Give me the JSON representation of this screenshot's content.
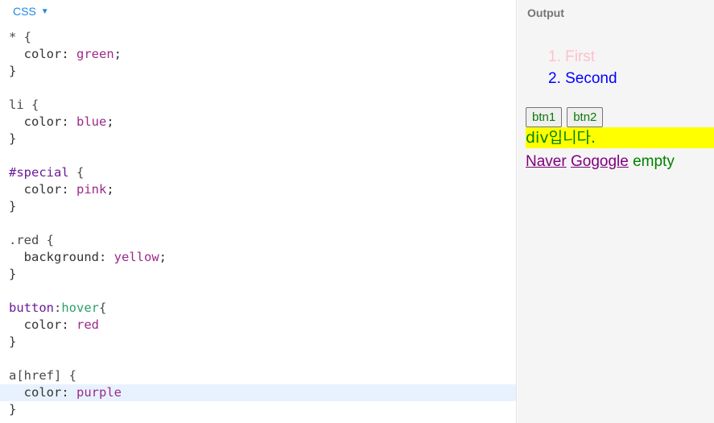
{
  "editor": {
    "language_label": "CSS",
    "lines": [
      [
        {
          "t": "* {",
          "c": "sel"
        }
      ],
      [
        {
          "t": "  color: ",
          "c": "prop"
        },
        {
          "t": "green",
          "c": "val"
        },
        {
          "t": ";",
          "c": "punc"
        }
      ],
      [
        {
          "t": "}",
          "c": "punc"
        }
      ],
      [],
      [
        {
          "t": "li {",
          "c": "sel"
        }
      ],
      [
        {
          "t": "  color: ",
          "c": "prop"
        },
        {
          "t": "blue",
          "c": "val"
        },
        {
          "t": ";",
          "c": "punc"
        }
      ],
      [
        {
          "t": "}",
          "c": "punc"
        }
      ],
      [],
      [
        {
          "t": "#special",
          "c": "id"
        },
        {
          "t": " {",
          "c": "sel"
        }
      ],
      [
        {
          "t": "  color: ",
          "c": "prop"
        },
        {
          "t": "pink",
          "c": "val"
        },
        {
          "t": ";",
          "c": "punc"
        }
      ],
      [
        {
          "t": "}",
          "c": "punc"
        }
      ],
      [],
      [
        {
          "t": ".red {",
          "c": "sel"
        }
      ],
      [
        {
          "t": "  background: ",
          "c": "prop"
        },
        {
          "t": "yellow",
          "c": "val"
        },
        {
          "t": ";",
          "c": "punc"
        }
      ],
      [
        {
          "t": "}",
          "c": "punc"
        }
      ],
      [],
      [
        {
          "t": "button",
          "c": "id"
        },
        {
          "t": ":",
          "c": "sel"
        },
        {
          "t": "hover",
          "c": "pseudo"
        },
        {
          "t": "{",
          "c": "sel"
        }
      ],
      [
        {
          "t": "  color: ",
          "c": "prop"
        },
        {
          "t": "red",
          "c": "val"
        }
      ],
      [
        {
          "t": "}",
          "c": "punc"
        }
      ],
      [],
      [
        {
          "t": "a[href] {",
          "c": "sel"
        }
      ],
      [
        {
          "t": "  color: ",
          "c": "prop"
        },
        {
          "t": "purple",
          "c": "val"
        }
      ],
      [
        {
          "t": "}",
          "c": "punc"
        }
      ]
    ],
    "active_line": 21
  },
  "output": {
    "title": "Output",
    "list_items": [
      "1. First",
      "2. Second"
    ],
    "buttons": [
      "btn1",
      "btn2"
    ],
    "div_text": "div입니다.",
    "link1": "Naver",
    "link2": "Gogogle",
    "trailing_text": "empty"
  }
}
